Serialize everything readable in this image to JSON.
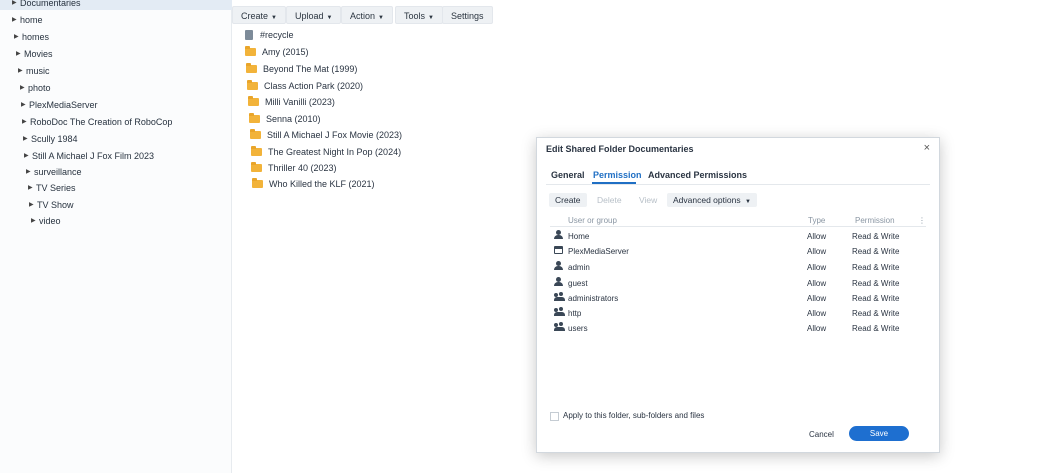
{
  "sidebar": {
    "items": [
      {
        "label": "Documentaries",
        "selected": true
      },
      {
        "label": "home"
      },
      {
        "label": "homes"
      },
      {
        "label": "Movies"
      },
      {
        "label": "music"
      },
      {
        "label": "photo"
      },
      {
        "label": "PlexMediaServer"
      },
      {
        "label": "RoboDoc The Creation of RoboCop"
      },
      {
        "label": "Scully 1984"
      },
      {
        "label": "Still A Michael J Fox Film 2023"
      },
      {
        "label": "surveillance"
      },
      {
        "label": "TV Series"
      },
      {
        "label": "TV Show"
      },
      {
        "label": "video"
      }
    ]
  },
  "toolbar": {
    "create": "Create",
    "upload": "Upload",
    "action": "Action",
    "tools": "Tools",
    "settings": "Settings"
  },
  "files": [
    {
      "name": "#recycle",
      "icon": "trash-icon"
    },
    {
      "name": "Amy (2015)",
      "icon": "folder-icon"
    },
    {
      "name": "Beyond The Mat (1999)",
      "icon": "folder-icon"
    },
    {
      "name": "Class Action Park (2020)",
      "icon": "folder-icon"
    },
    {
      "name": "Milli Vanilli (2023)",
      "icon": "folder-icon"
    },
    {
      "name": "Senna (2010)",
      "icon": "folder-icon"
    },
    {
      "name": "Still A Michael J Fox Movie (2023)",
      "icon": "folder-icon"
    },
    {
      "name": "The Greatest Night In Pop (2024)",
      "icon": "folder-icon"
    },
    {
      "name": "Thriller 40 (2023)",
      "icon": "folder-icon"
    },
    {
      "name": "Who Killed the KLF (2021)",
      "icon": "folder-icon"
    }
  ],
  "dialog": {
    "title": "Edit Shared Folder Documentaries",
    "close": "×",
    "tabs": [
      "General",
      "Permission",
      "Advanced Permissions"
    ],
    "active_tab": "Permission",
    "buttons": {
      "create": "Create",
      "delete": "Delete",
      "view": "View",
      "advanced": "Advanced options"
    },
    "columns": {
      "user": "User or group",
      "type": "Type",
      "permission": "Permission",
      "menu": "⋮"
    },
    "rows": [
      {
        "name": "Home",
        "type": "Allow",
        "permission": "Read & Write",
        "icon": "user-icon"
      },
      {
        "name": "PlexMediaServer",
        "type": "Allow",
        "permission": "Read & Write",
        "icon": "window-icon"
      },
      {
        "name": "admin",
        "type": "Allow",
        "permission": "Read & Write",
        "icon": "user-icon"
      },
      {
        "name": "guest",
        "type": "Allow",
        "permission": "Read & Write",
        "icon": "user-icon"
      },
      {
        "name": "administrators",
        "type": "Allow",
        "permission": "Read & Write",
        "icon": "group-icon"
      },
      {
        "name": "http",
        "type": "Allow",
        "permission": "Read & Write",
        "icon": "group-icon"
      },
      {
        "name": "users",
        "type": "Allow",
        "permission": "Read & Write",
        "icon": "group-icon"
      }
    ],
    "apply_label": "Apply to this folder, sub-folders and files",
    "cancel": "Cancel",
    "save": "Save"
  },
  "colors": {
    "accent": "#1e6fd0",
    "folder": "#f2b33a"
  }
}
